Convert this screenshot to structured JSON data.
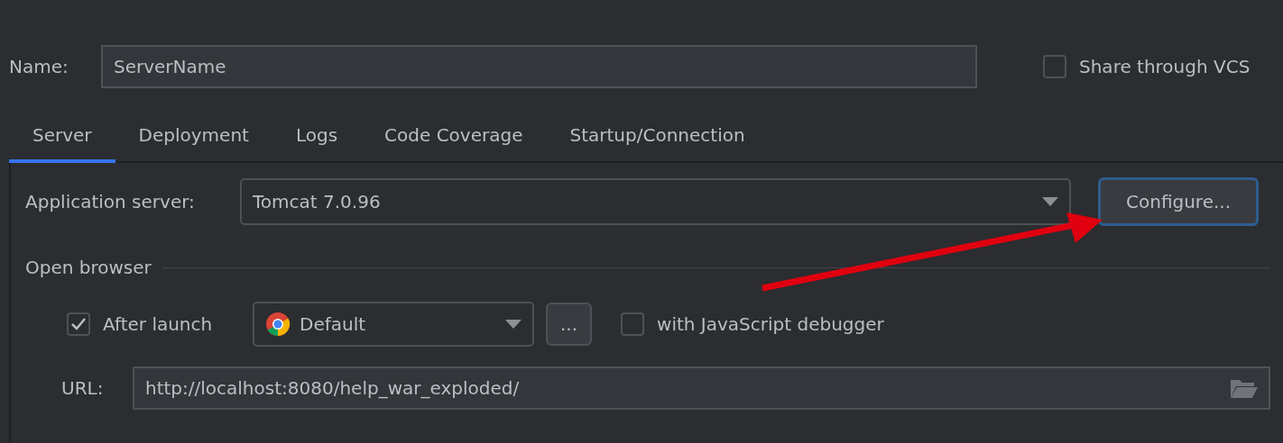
{
  "name_field": {
    "label": "Name:",
    "value": "ServerName"
  },
  "share_vcs": {
    "label": "Share through VCS",
    "checked": false
  },
  "tabs": [
    {
      "label": "Server",
      "selected": true
    },
    {
      "label": "Deployment",
      "selected": false
    },
    {
      "label": "Logs",
      "selected": false
    },
    {
      "label": "Code Coverage",
      "selected": false
    },
    {
      "label": "Startup/Connection",
      "selected": false
    }
  ],
  "application_server": {
    "label": "Application server:",
    "value": "Tomcat 7.0.96",
    "button": "Configure...",
    "button_focused": true
  },
  "open_browser": {
    "title": "Open browser",
    "after_launch": {
      "label": "After launch",
      "checked": true
    },
    "browser": {
      "value": "Default"
    },
    "more_button": "...",
    "js_debugger": {
      "label": "with JavaScript debugger",
      "checked": false
    },
    "url": {
      "label": "URL:",
      "value": "http://localhost:8080/help_war_exploded/"
    }
  },
  "annotation_arrow": true
}
